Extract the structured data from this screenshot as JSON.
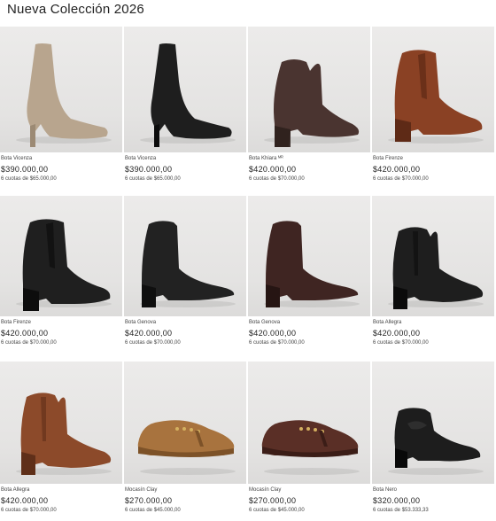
{
  "page": {
    "title": "Nueva Colección 2026"
  },
  "products": [
    {
      "name": "Bota Vicenza",
      "price": "$390.000,00",
      "installments": "6 cuotas de $65.000,00",
      "icon": "tan-suede-kitten-heel-boot-icon",
      "color": "#b8a58e",
      "shade": "#9c8a74"
    },
    {
      "name": "Bota Vicenza",
      "price": "$390.000,00",
      "installments": "6 cuotas de $65.000,00",
      "icon": "black-suede-kitten-heel-boot-icon",
      "color": "#1e1e1e",
      "shade": "#0c0c0c"
    },
    {
      "name": "Bota Khiara ᴹᴿ",
      "price": "$420.000,00",
      "installments": "6 cuotas de $70.000,00",
      "icon": "brown-leather-block-heel-boot-icon",
      "color": "#4a3430",
      "shade": "#2e201d"
    },
    {
      "name": "Bota Firenze",
      "price": "$420.000,00",
      "installments": "6 cuotas de $70.000,00",
      "icon": "cognac-leather-chelsea-boot-icon",
      "color": "#8a4124",
      "shade": "#5e2a16"
    },
    {
      "name": "Bota Firenze",
      "price": "$420.000,00",
      "installments": "6 cuotas de $70.000,00",
      "icon": "black-leather-chelsea-boot-icon",
      "color": "#1f1f1f",
      "shade": "#0d0d0d"
    },
    {
      "name": "Bota Genova",
      "price": "$420.000,00",
      "installments": "6 cuotas de $70.000,00",
      "icon": "black-leather-pointed-boot-icon",
      "color": "#222222",
      "shade": "#0f0f0f"
    },
    {
      "name": "Bota Genova",
      "price": "$420.000,00",
      "installments": "6 cuotas de $70.000,00",
      "icon": "brown-leather-pointed-boot-icon",
      "color": "#3f2522",
      "shade": "#261513"
    },
    {
      "name": "Bota Allegra",
      "price": "$420.000,00",
      "installments": "6 cuotas de $70.000,00",
      "icon": "black-leather-western-boot-icon",
      "color": "#1e1e1e",
      "shade": "#0b0b0b"
    },
    {
      "name": "Bota Allegra",
      "price": "$420.000,00",
      "installments": "6 cuotas de $70.000,00",
      "icon": "cognac-leather-western-boot-icon",
      "color": "#8c4a2a",
      "shade": "#5f2f19"
    },
    {
      "name": "Mocasín Clay",
      "price": "$270.000,00",
      "installments": "6 cuotas de $45.000,00",
      "icon": "tan-suede-moccasin-icon",
      "color": "#a8733e",
      "shade": "#7d5228"
    },
    {
      "name": "Mocasín Clay",
      "price": "$270.000,00",
      "installments": "6 cuotas de $45.000,00",
      "icon": "brown-suede-moccasin-icon",
      "color": "#5a2f26",
      "shade": "#3b1d17"
    },
    {
      "name": "Bota Nero",
      "price": "$320.000,00",
      "installments": "6 cuotas de $53.333,33",
      "icon": "black-leather-ankle-bootie-icon",
      "color": "#1d1d1d",
      "shade": "#090909"
    }
  ]
}
